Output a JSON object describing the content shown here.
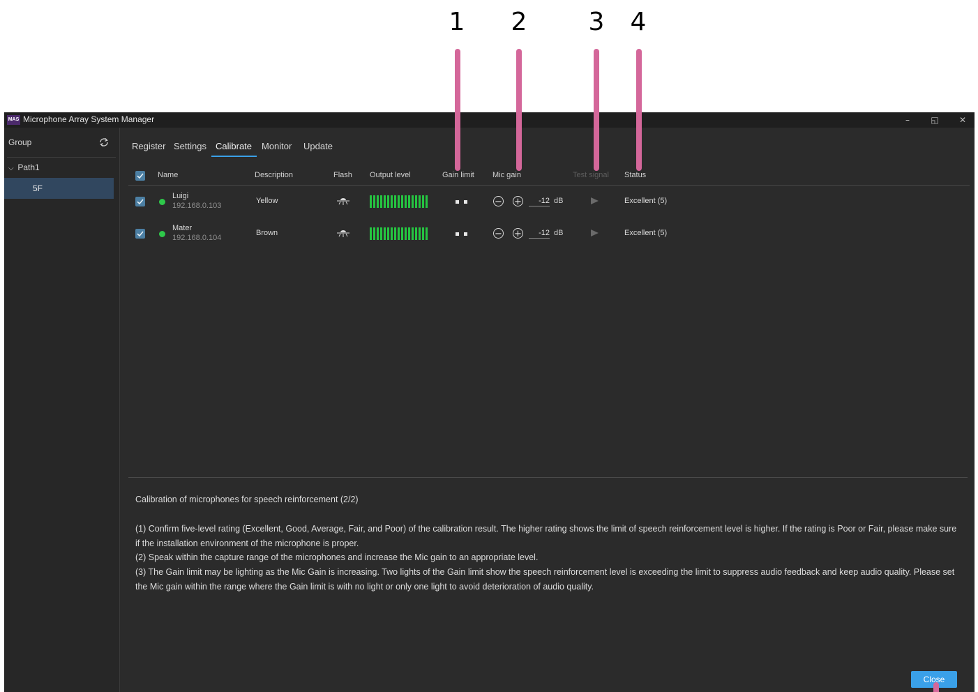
{
  "callouts": [
    "1",
    "2",
    "3",
    "4"
  ],
  "window": {
    "logo": "MAS",
    "title": "Microphone Array System Manager",
    "controls": [
      "–",
      "◱",
      "✕"
    ]
  },
  "sidebar": {
    "group_label": "Group",
    "refresh_icon": "refresh-icon",
    "tree": {
      "path": "Path1",
      "floor": "5F"
    }
  },
  "tabs": [
    {
      "label": "Register",
      "active": false
    },
    {
      "label": "Settings",
      "active": false
    },
    {
      "label": "Calibrate",
      "active": true
    },
    {
      "label": "Monitor",
      "active": false
    },
    {
      "label": "Update",
      "active": false
    }
  ],
  "table": {
    "headers": {
      "name": "Name",
      "description": "Description",
      "flash": "Flash",
      "output_level": "Output level",
      "gain_limit": "Gain limit",
      "mic_gain": "Mic gain",
      "test_signal": "Test signal",
      "status": "Status"
    },
    "rows": [
      {
        "name": "Luigi",
        "ip": "192.168.0.103",
        "description": "Yellow",
        "gain_limit_lights": 2,
        "mic_gain": "-12",
        "unit": "dB",
        "status": "Excellent (5)",
        "connected": true
      },
      {
        "name": "Mater",
        "ip": "192.168.0.104",
        "description": "Brown",
        "gain_limit_lights": 2,
        "mic_gain": "-12",
        "unit": "dB",
        "status": "Excellent (5)",
        "connected": true
      }
    ]
  },
  "info": {
    "title": "Calibration of microphones for speech reinforcement (2/2)",
    "paragraphs": [
      "(1) Confirm five-level rating (Excellent, Good, Average, Fair, and Poor) of the calibration result. The higher rating shows the limit of speech reinforcement level is higher. If the rating is Poor or Fair, please make sure if the installation environment of the microphone is proper.",
      "(2) Speak within the capture range of the microphones and increase the Mic gain to an appropriate level.",
      "(3) The Gain limit may be lighting as the Mic Gain is increasing. Two lights of the Gain limit show the speech reinforcement level is exceeding the limit to suppress audio feedback and keep audio quality. Please set the Mic gain within the range where the Gain limit is with no light or only one light to avoid deterioration of audio quality."
    ]
  },
  "close_button": "Close",
  "colors": {
    "accent": "#3aa0e8",
    "callout": "#d4679a",
    "meter": "#25c441",
    "status_dot": "#2ec84a"
  }
}
